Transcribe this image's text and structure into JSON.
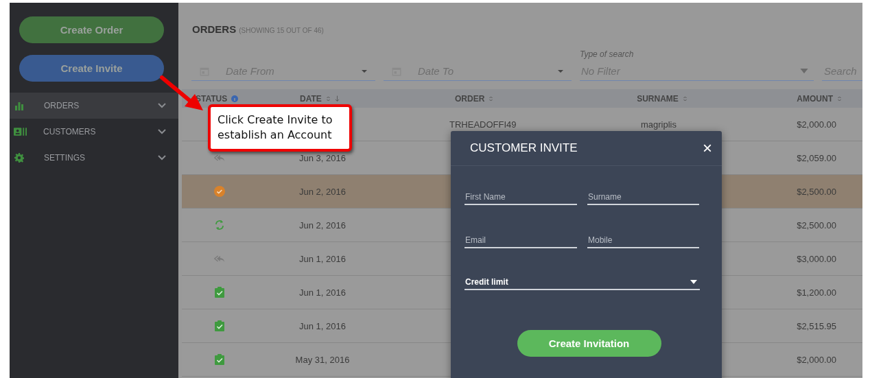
{
  "sidebar": {
    "buttons": [
      {
        "label": "Create Order",
        "kind": "order"
      },
      {
        "label": "Create Invite",
        "kind": "invite"
      }
    ],
    "items": [
      {
        "label": "ORDERS",
        "selected": true
      },
      {
        "label": "CUSTOMERS",
        "selected": false
      },
      {
        "label": "SETTINGS",
        "selected": false
      }
    ]
  },
  "orders": {
    "title": "ORDERS",
    "subtitle": "(SHOWING 15 OUT OF 46)",
    "filters": {
      "date_from": {
        "placeholder": "Date From"
      },
      "date_to": {
        "placeholder": "Date To"
      },
      "type_of_search": {
        "label": "Type of search",
        "value": "No Filter"
      },
      "search": {
        "placeholder": "Search"
      }
    },
    "table": {
      "columns": [
        "STATUS",
        "DATE",
        "ORDER",
        "SURNAME",
        "AMOUNT"
      ],
      "rows": [
        {
          "order": "TRHEADOFFI49",
          "surname": "magriplis",
          "amount": "$2,000.00",
          "selected": false
        },
        {
          "kind": "replied",
          "date": "Jun 3, 2016",
          "amount": "$2,059.00",
          "selected": false
        },
        {
          "kind": "approved",
          "date": "Jun 2, 2016",
          "amount": "$2,500.00",
          "selected": true
        },
        {
          "kind": "processing",
          "date": "Jun 2, 2016",
          "amount": "$2,500.00",
          "selected": false
        },
        {
          "kind": "replied",
          "date": "Jun 1, 2016",
          "amount": "$3,000.00",
          "selected": false
        },
        {
          "kind": "completed",
          "date": "Jun 1, 2016",
          "amount": "$1,200.00",
          "selected": false
        },
        {
          "kind": "completed",
          "date": "Jun 1, 2016",
          "amount": "$2,515.95",
          "selected": false
        },
        {
          "kind": "completed",
          "date": "May 31, 2016",
          "amount": "$2,000.00",
          "selected": false
        }
      ]
    }
  },
  "dialog": {
    "title": "CUSTOMER INVITE",
    "close": "×",
    "fields": [
      {
        "placeholder": "First Name"
      },
      {
        "placeholder": "Surname"
      },
      {
        "placeholder": "Email"
      },
      {
        "placeholder": "Mobile"
      }
    ],
    "select": {
      "value": "Credit limit"
    },
    "button": "Create Invitation"
  },
  "callout": {
    "text": "Click Create Invite to establish an Account"
  }
}
